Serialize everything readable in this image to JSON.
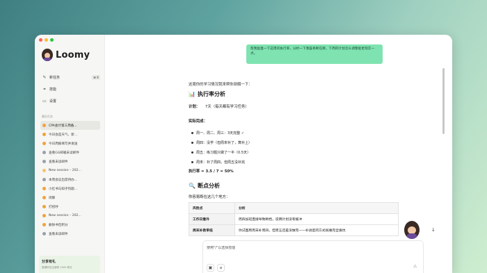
{
  "app": {
    "name": "Loomy"
  },
  "window_controls": {
    "colors": [
      "#ff5f57",
      "#febc2e",
      "#28c840"
    ]
  },
  "sidebar": {
    "nav": [
      {
        "label": "新任务",
        "icon": "edit-icon",
        "shortcut": "⌘ K"
      },
      {
        "label": "技能",
        "icon": "link-icon"
      },
      {
        "label": "设置",
        "icon": "folder-icon"
      }
    ],
    "section_label": "最近任务",
    "tasks": [
      {
        "label": "CPA会计第三周备...",
        "active": true,
        "dot": "#f0a23a"
      },
      {
        "label": "今日会是天气、新...",
        "dot": "#f0a23a"
      },
      {
        "label": "今日周报填写并发送",
        "dot": "#f0a23a"
      },
      {
        "label": "查看GG邮箱未读邮件",
        "dot": "#9aa0a8"
      },
      {
        "label": "查看未读邮件",
        "dot": "#9aa0a8"
      },
      {
        "label": "New session – 202...",
        "dot": "#f6c46a"
      },
      {
        "label": "本周会议出席待办...",
        "dot": "#9aa0a8"
      },
      {
        "label": "小红书与知乎热题...",
        "dot": "#f0a23a"
      },
      {
        "label": "闲聊",
        "dot": "#f0a23a"
      },
      {
        "label": "打招呼",
        "dot": "#f0a23a"
      },
      {
        "label": "New session – 202...",
        "dot": "#f0a23a"
      },
      {
        "label": "删除书包积分",
        "dot": "#f0a23a"
      },
      {
        "label": "查看未读邮件",
        "dot": "#9aa0a8"
      }
    ],
    "share": {
      "title": "分享有礼",
      "subtitle": "邀请好友注册获 2000 积分"
    }
  },
  "chat": {
    "user_message": "帮我复盘一下这周的执行率，分析一下我容易断在哪，下周的计划怎么调整能更现实一点。",
    "intro": "这周你的学习情况我来帮你剖解一下：",
    "section1": {
      "icon": "📊",
      "title": "执行率分析"
    },
    "plan": {
      "label": "计划：",
      "value": "7天（每天都有学习任务）"
    },
    "actual_label": "实际完成：",
    "bullets": [
      "周一、周二、周三：3天完整 ✓",
      "周四：没学（但周末补了，算补上）",
      "周五：练习题只做了一半（0.5天）",
      "周末：补了周四，但周五没补完"
    ],
    "rate": "执行率 = 3.5 / 7 = 50%",
    "section2": {
      "icon": "🔍",
      "title": "断点分析"
    },
    "section2_lead": "你容易断在这几个地方：",
    "table": {
      "headers": [
        "风险点",
        "分析"
      ],
      "rows": [
        [
          "工作日意外",
          "周四加班直接导致断档，说明计划没有缓冲"
        ],
        [
          "周末补救审低",
          "你试图用周末补周四，但周五还是没做完——补进度的方式很难完全填坑"
        ]
      ]
    },
    "composer": {
      "placeholder": "使用\"/\"以选择技能"
    }
  }
}
